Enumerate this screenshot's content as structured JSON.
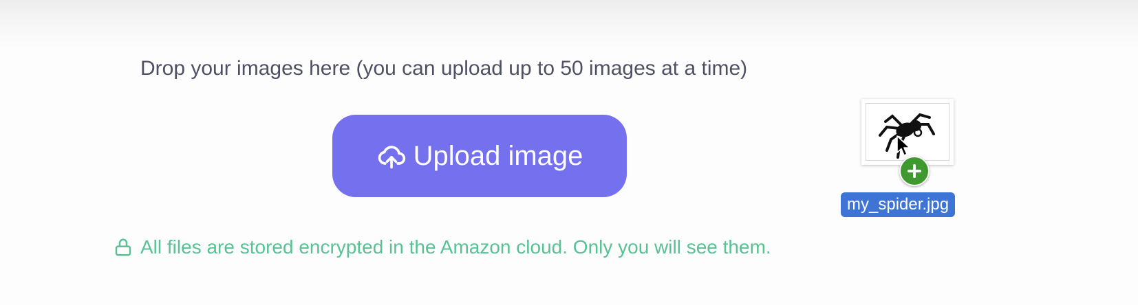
{
  "dropzone": {
    "instruction": "Drop your images here (you can upload up to 50 images at a time)"
  },
  "upload_button": {
    "label": "Upload image",
    "icon": "cloud-upload-icon",
    "color": "#7570ee"
  },
  "security_note": {
    "text": "All files are stored encrypted in the Amazon cloud. Only you will see them.",
    "icon": "lock-icon",
    "color": "#58c295"
  },
  "dragged_file": {
    "name": "my_spider.jpg",
    "thumbnail_icon": "spider-icon",
    "badge_icon": "plus-icon",
    "label_color": "#3d74d6"
  }
}
